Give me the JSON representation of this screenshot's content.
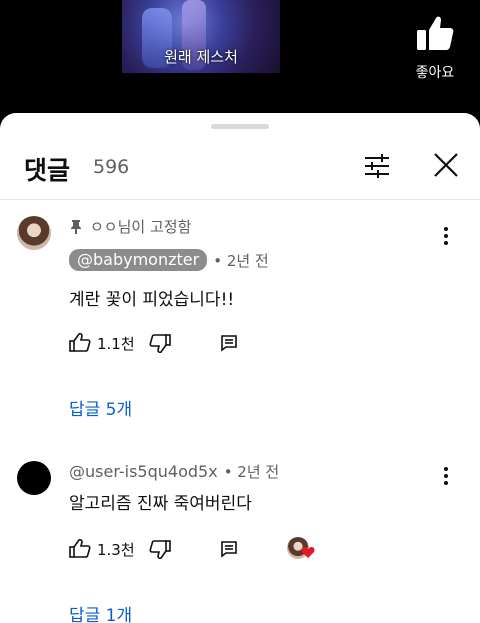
{
  "video": {
    "caption": "원래 제스처",
    "like_label": "좋아요"
  },
  "comments_panel": {
    "title": "댓글",
    "count": "596"
  },
  "comments": [
    {
      "pinned_text": "ㅇㅇ님이 고정함",
      "author": "@babymonzter",
      "time": "• 2년 전",
      "text": "계란 꽃이 피었습니다!!",
      "likes": "1.1천",
      "replies": "답글 5개"
    },
    {
      "author": "@user-is5qu4od5x",
      "time": "• 2년 전",
      "text": "알고리즘 진짜 죽여버린다",
      "likes": "1.3천",
      "replies": "답글 1개"
    }
  ],
  "colors": {
    "link_blue": "#065fd4",
    "heart_red": "#e01b24",
    "secondary_text": "#606060"
  }
}
